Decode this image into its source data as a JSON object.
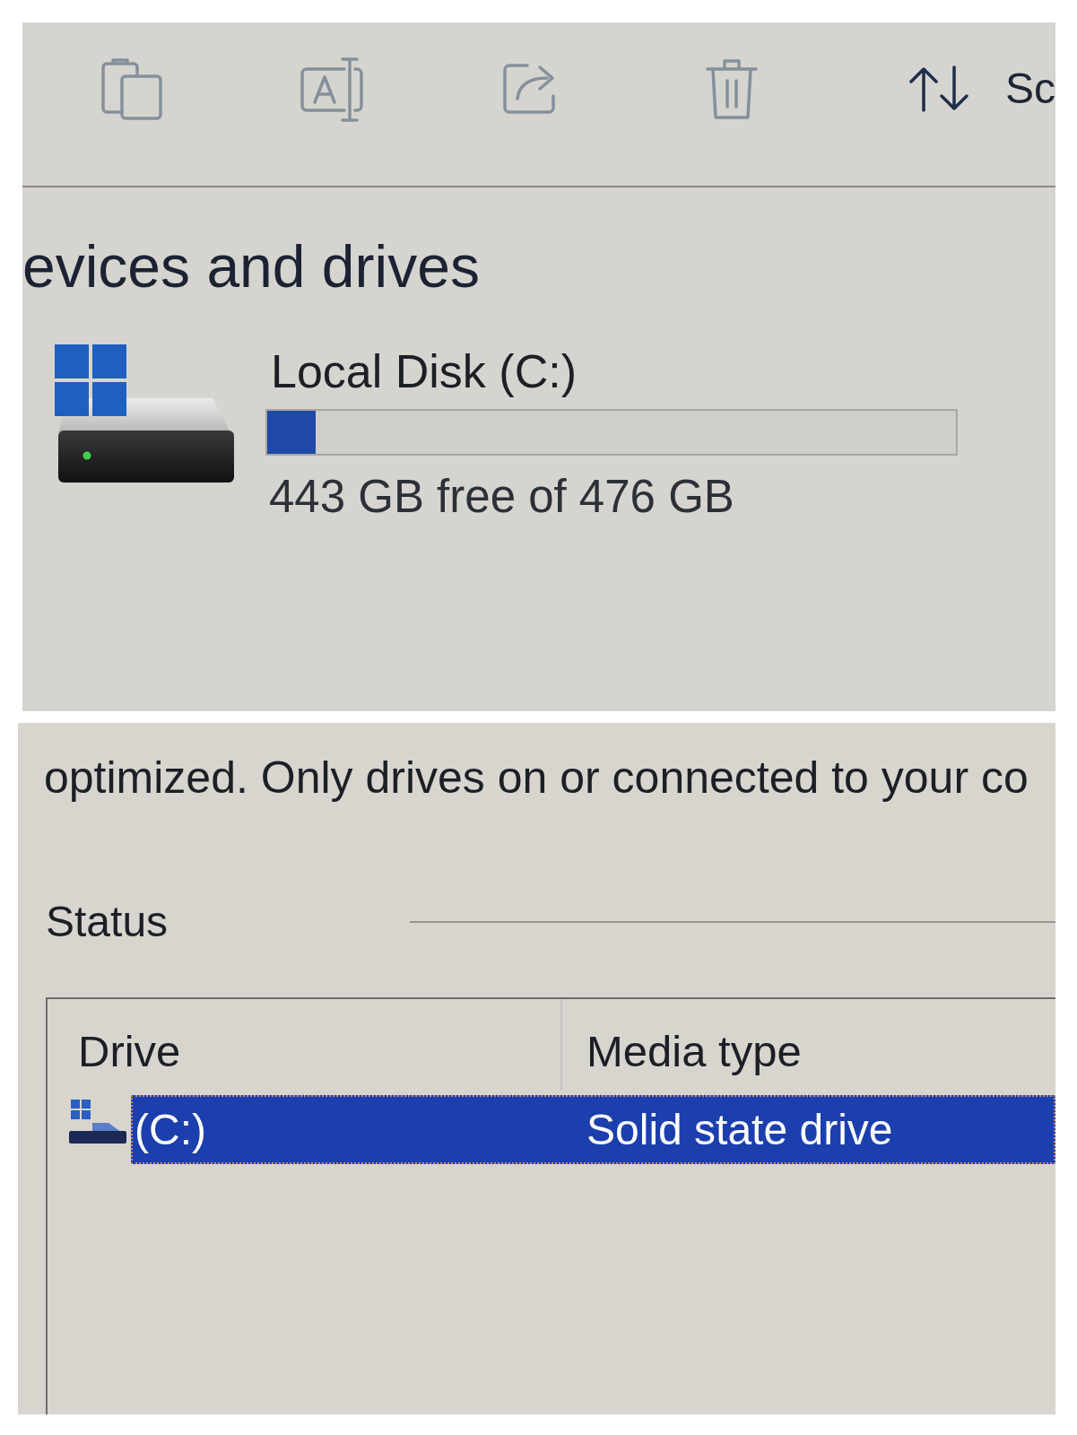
{
  "toolbar": {
    "buttons": [
      {
        "kind": "copy",
        "disabled": true
      },
      {
        "kind": "rename",
        "disabled": true
      },
      {
        "kind": "share",
        "disabled": true
      },
      {
        "kind": "delete",
        "disabled": true
      },
      {
        "kind": "sort",
        "label": "Sc",
        "disabled": false
      }
    ]
  },
  "devices": {
    "heading": "evices and drives",
    "drives": [
      {
        "name": "Local Disk (C:)",
        "level": 0.07,
        "free_text": "443 GB free of 476 GB"
      }
    ]
  },
  "optimize": {
    "description": "optimized. Only drives on or connected to your co",
    "status_label": "Status",
    "table": {
      "columns": [
        "Drive",
        "Media type"
      ],
      "rows": [
        {
          "drive": "(C:)",
          "media_type": "Solid state drive",
          "selected": true
        }
      ]
    }
  }
}
